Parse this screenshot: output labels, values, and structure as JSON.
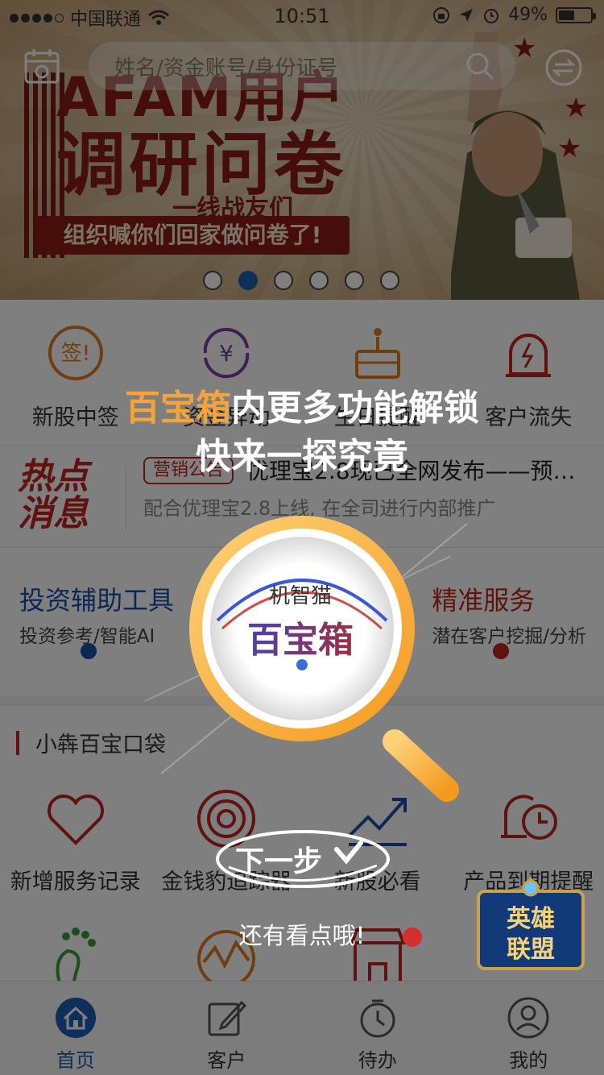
{
  "status_bar": {
    "carrier": "中国联通",
    "time": "10:51",
    "battery": "49%"
  },
  "banner": {
    "search_placeholder": "姓名/资金账号/身份证号",
    "title_line1": "AFAM用户",
    "title_line2": "调研问卷",
    "subtitle": "一线战友们",
    "ribbon": "组织喊你们回家做问卷了!",
    "pager_count": 6,
    "pager_active_index": 1
  },
  "quick_menu": [
    {
      "label": "新股中签",
      "icon": "sign-badge-icon"
    },
    {
      "label": "资金异动",
      "icon": "yuan-cycle-icon"
    },
    {
      "label": "生日提醒",
      "icon": "birthday-cake-icon"
    },
    {
      "label": "客户流失",
      "icon": "alarm-bell-icon"
    }
  ],
  "news": {
    "logo_line1": "热点",
    "logo_line2": "消息",
    "tag": "营销公告",
    "title": "优理宝2.8现已全网发布——预…",
    "subtitle": "配合优理宝2.8上线, 在全司进行内部推广"
  },
  "tools": {
    "left": {
      "title": "投资辅助工具",
      "subtitle": "投资参考/智能AI"
    },
    "right": {
      "title": "精准服务",
      "subtitle": "潜在客户挖掘/分析"
    }
  },
  "pocket": {
    "title": "小犇百宝口袋",
    "row1": [
      {
        "label": "新增服务记录",
        "icon": "heart-icon"
      },
      {
        "label": "金钱豹追踪器",
        "icon": "target-icon"
      },
      {
        "label": "新股必看",
        "icon": "trend-chart-icon"
      },
      {
        "label": "产品到期提醒",
        "icon": "bell-clock-icon"
      }
    ],
    "row2": [
      {
        "icon": "footprint-icon"
      },
      {
        "icon": "wave-chart-icon"
      },
      {
        "icon": "shop-icon"
      }
    ]
  },
  "tabs": [
    {
      "label": "首页",
      "icon": "home-icon",
      "active": true
    },
    {
      "label": "客户",
      "icon": "edit-icon",
      "active": false
    },
    {
      "label": "待办",
      "icon": "stopwatch-icon",
      "active": false
    },
    {
      "label": "我的",
      "icon": "user-icon",
      "active": false
    }
  ],
  "overlay": {
    "hint_highlight": "百宝箱",
    "hint_rest": "内更多功能解锁",
    "hint_line2": "快来一探究竟",
    "magnifier_small": "机智猫",
    "magnifier_big": "百宝箱",
    "next_button": "下一步",
    "hint_bottom": "还有看点哦!"
  },
  "game_badge": {
    "line1": "英雄",
    "line2": "联盟"
  },
  "colors": {
    "accent_blue": "#1a5fb4",
    "brand_red": "#c0251c",
    "highlight_orange": "#f4a43b"
  }
}
